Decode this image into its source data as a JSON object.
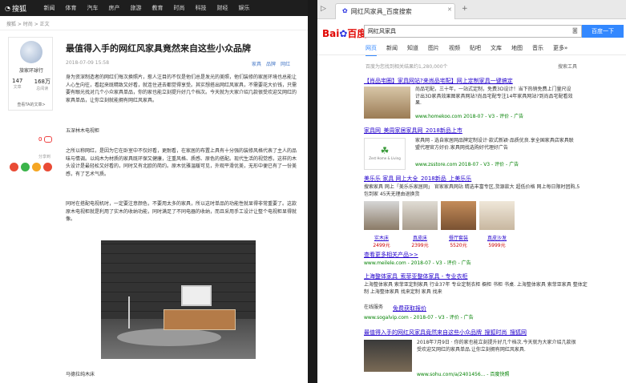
{
  "sohu": {
    "logo": "搜狐",
    "nav": [
      "新闻",
      "体育",
      "汽车",
      "房产",
      "旅游",
      "教育",
      "时尚",
      "科技",
      "财经",
      "娱乐"
    ],
    "breadcrumb": "搜狐 > 时尚 > 正文",
    "author": {
      "name": "旅家环球行",
      "articles": "147",
      "articles_label": "文章",
      "reads": "168万",
      "reads_label": "总阅读",
      "all_articles": "查看TA的文章>"
    },
    "title": "最值得入手的网红风家具竟然来自这些小众品牌",
    "date": "2018-07-09 15:58",
    "tags": [
      "家具",
      "品牌",
      "网红"
    ],
    "comments": "0",
    "share_label": "分享到",
    "para1": "身为资深制造者的网红们每次换照片，惹人注目的不仅是他们总是发光的美照，他们装修的家居环境也总能让人心生向往，看起来既精致又好看，就连住进去都觉得享受。其实想搭出网红风家具，不需要花大价钱，只需要有眼光找对几个小众家具单品，你的家也能立刻提升好几个档次。今天就为大家介绍几款很受欢迎又网红的家具单品，让你立刻就能拥有网红风家具。",
    "sub1": "五深林木电视柜",
    "para2": "之所以称网红，是因为它在卧室中不仅好看，更耐看，在家居的布置上具有十分强的装修风格代表了主人的品味与情调。以纯木为材质的家具既环保又健康，注重风格、质感、原色的搭配。现代生活的视觉感，这样的木头设计是最轻松又好看的，同时又有北欧的简约。原木优雅温暖可见，外观平滑优美，无形中便已有了一份美感，有了艺术气质。",
    "para3": "同时在搭配电视机时，一定要注意颜色，不要用太多的家具，所以这时单品的功能性就显得非常重要了。这款原木电视柜就是利用了实木的收纳功能，同时满足了不同电器的收纳，而且采用手工设计让整个电视柜显得就像。",
    "caption": "马德拉纯木床"
  },
  "browser": {
    "tab_title": "网红风家具_百度搜索",
    "query": "网红风家具",
    "search_button": "百度一下",
    "logo_text_bai": "Bai",
    "logo_text_du": "百度",
    "tabs": [
      "网页",
      "新闻",
      "知道",
      "图片",
      "视频",
      "贴吧",
      "文库",
      "地图",
      "音乐",
      "更多»"
    ],
    "result_count": "百度为您找到相关结果约1,280,000个",
    "search_tools": "搜索工具",
    "results": [
      {
        "title": "【肖品宅圈】家具网站?来尚品宅配】网上定制家具一键搞定",
        "text": "尚品宅配，三十年，一站式定制，免费3D设计！当下热销免费上门量尺设计出3D家具效果图家具网站?尚品宅配专注14年家具网站?到尚品宅配看效果.",
        "url": "www.homekoo.com 2018-07 - V3 - 评价 - 广告"
      },
      {
        "title": "家具网_美周家居家具网_2018新品上市",
        "text": "家具网 - 选自家居网品牌定制设计·款式新颖·品质优良.享全国家具店家具联盟代理官方好价.家具网找选购好代理好广告",
        "url": "www.zsstore.com 2018-07 - V3 - 评价 - 广告"
      },
      {
        "title": "美乐乐 家具 网上大全_2018新品_上美乐乐",
        "text": "搜索家具 网上「美乐乐家居网」 官家家具网站 精选丰富专区,货源款大 超低价格 网上每日限时团购,5包到家 45天无理由退换货",
        "url": "www.meilele.com - 2018-07 - V3 - 评价 - 广告"
      },
      {
        "title": "上海整体家具_索菲亚整体家具 - 专业衣柜",
        "text": "上海整体家具 索菲亚定制家具 行业37年 专业定制衣柜 橱柜 书柜 书桌. 上海整体家具 索菲亚家具 整体定制 上海整体家具 找来定制 家具 找来",
        "url": "www.sogalvip.com - 2018-07 - V3 - 评价 - 广告"
      },
      {
        "title": "最值得入手的网红风家具竟然来自这些小众品牌_搜狐时尚_搜狐网",
        "text": "2018年7月9日 · 你的家也能立刻提升好几个档次.今天就为大家介绍几款很受欢迎又网红的家具单品.让你立刻拥有网红风家具.",
        "url": "www.sohu.com/a/2401456... - 百度快照"
      }
    ],
    "products": [
      {
        "name": "实木床",
        "price": "2499元"
      },
      {
        "name": "真皮床",
        "price": "2399元"
      },
      {
        "name": "餐厅套装",
        "price": "5520元"
      },
      {
        "name": "真皮沙发",
        "price": "5999元"
      }
    ],
    "more_products": "查看更多相关产品>>",
    "online": "在线服务",
    "online_link": "免费获取报价"
  }
}
